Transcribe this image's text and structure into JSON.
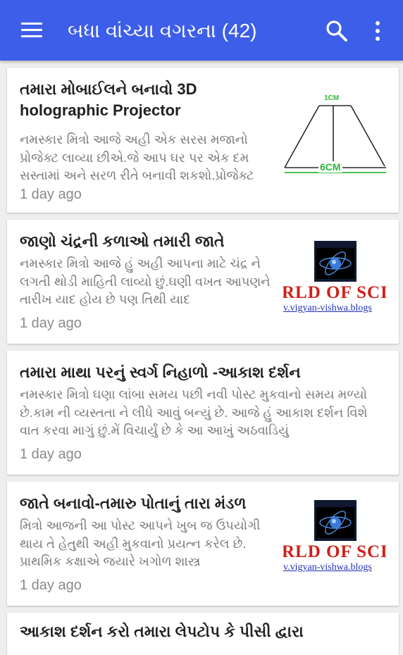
{
  "app_bar": {
    "title": "બધા વાંચ્યા વગરના (42)",
    "color": "#3d5ee8",
    "icons": [
      "menu-icon",
      "search-icon",
      "more-vert-icon"
    ]
  },
  "posts": [
    {
      "title": "તમારા મોબાઈલને બનાવો 3D holographic Projector",
      "snippet": "નમસ્કાર મિત્રો  આજે અહી એક સરસ મજાનો પ્રોજેક્ટ લાવ્યા છીએ.જે આપ ઘર પર એક દમ સસ્તામાં અને સરળ રીતે બનાવી શકશો.પ્રોજેક્ટ",
      "time": "1 day ago",
      "thumb": {
        "top_label": "1CM",
        "bottom_label": "6CM"
      }
    },
    {
      "title": "જાણો ચંદ્રની કળાઓ તમારી જાતે",
      "snippet": "નમસ્કાર મિત્રો  આજે હું અહી આપના માટે ચંદ્ર ને લગતી થોડી માહિતી લાવ્યો છું.ઘણી વખત આપણને તારીખ યાદ હોય છે પણ તિથી યાદ",
      "time": "1 day ago",
      "thumb": {
        "red_text": "RLD OF SCIE",
        "blue_text": "v.vigyan-vishwa.blogs"
      }
    },
    {
      "title": "તમારા માથા પરનું સ્વર્ગ નિહાળો -આકાશ દર્શન",
      "snippet": "નમસ્કાર મિત્રો  ઘણા લાંબા સમય પછી નવી પોસ્ટ મુકવાનો સમય મળ્યો છે.કામ ની વ્યસ્તતા ને લીધે આવું બન્યું છે. આજે હું આકાશ દર્શન વિશે વાત કરવા માગું છું.મેં વિચાર્યું છે કે આ આખું અઠવાડિયું",
      "time": "1 day ago"
    },
    {
      "title": "જાતે બનાવો-તમારુ પોતાનું તારા મંડળ",
      "snippet": "મિત્રો આજની આ પોસ્ટ આપને ખુબ જ ઉપયોગી થાય તે હેતુથી અહી મુકવાનો પ્રયત્ન કરેલ છે. પ્રાથમિક કક્ષાએ જયારે ખગોળ શાસ્ત્ર",
      "time": "1 day ago",
      "thumb": {
        "red_text": "RLD OF SCIE",
        "blue_text": "v.vigyan-vishwa.blogs"
      }
    },
    {
      "title": "આકાશ દર્શન કરો તમારા લેપટોપ કે પીસી દ્વારા"
    }
  ]
}
